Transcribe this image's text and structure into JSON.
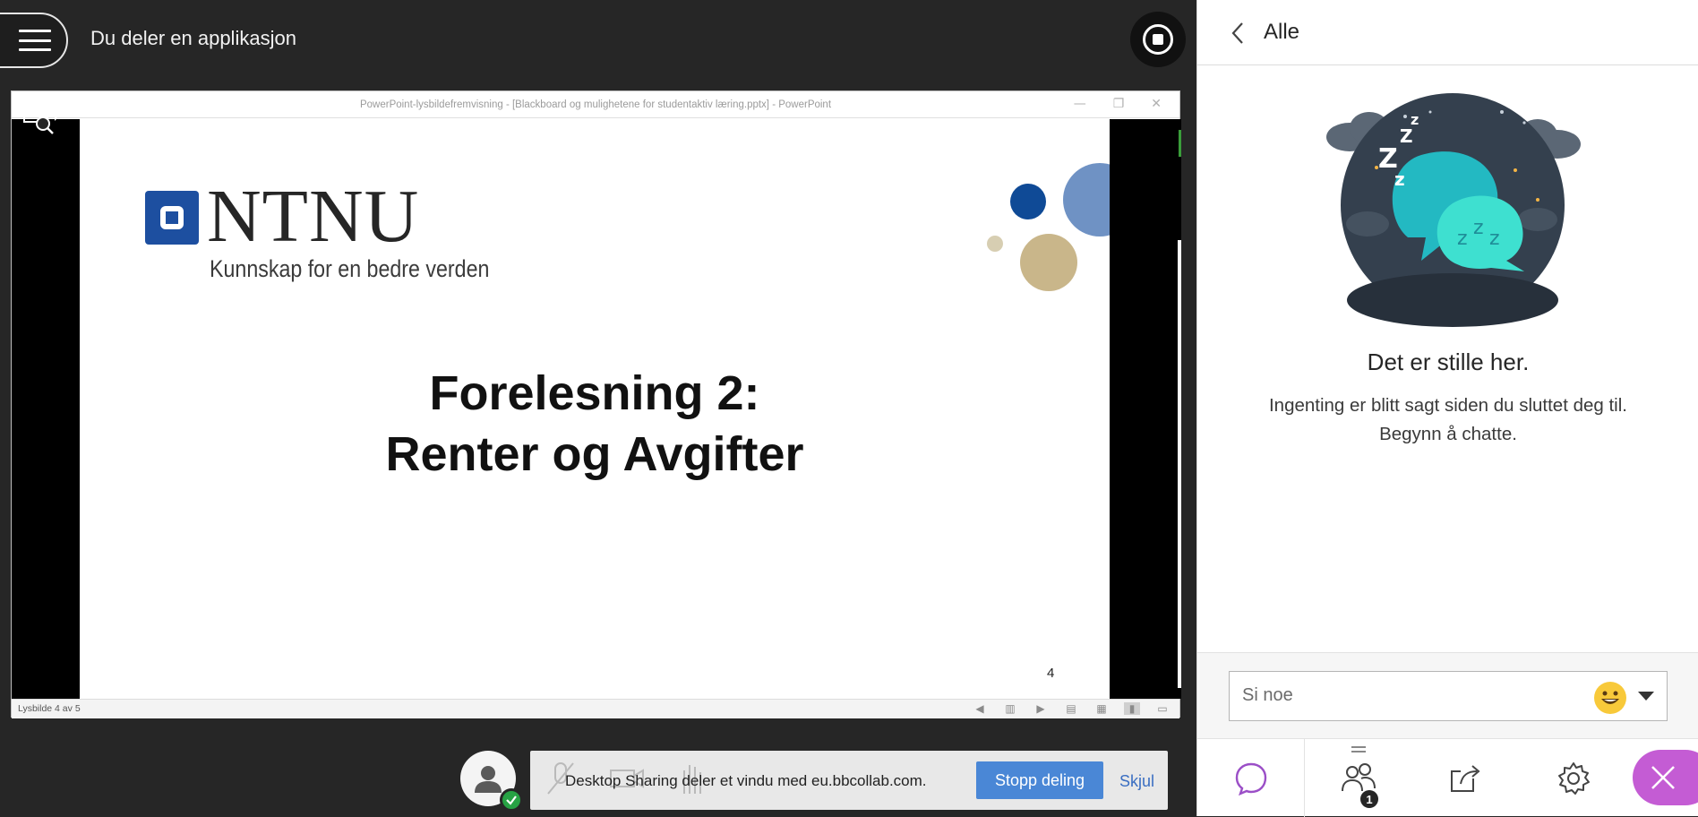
{
  "app": {
    "sharing_title": "Du deler en applikasjon"
  },
  "shared_window": {
    "titlebar": "PowerPoint-lysbildefremvisning - [Blackboard og mulighetene for studentaktiv læring.pptx] - PowerPoint",
    "slide": {
      "logo_word": "NTNU",
      "tagline": "Kunnskap for en bedre verden",
      "title_line1": "Forelesning 2:",
      "title_line2": "Renter og Avgifter",
      "number": "4"
    },
    "status": "Lysbilde 4 av 5"
  },
  "share_bar": {
    "message": "Desktop Sharing deler et vindu med eu.bbcollab.com.",
    "stop_label": "Stopp deling",
    "hide_label": "Skjul"
  },
  "panel": {
    "header_title": "Alle",
    "empty_heading": "Det er stille her.",
    "empty_line1": "Ingenting er blitt sagt siden du sluttet deg til.",
    "empty_line2": "Begynn å chatte.",
    "compose_placeholder": "Si noe",
    "participants_badge": "1"
  },
  "colors": {
    "accent_blue": "#4a87d6",
    "close_purple": "#c45cd4",
    "chat_active": "#9b4fc7",
    "ntnu_blue": "#1d4fa0"
  },
  "icons": [
    "menu-icon",
    "stop-share-icon",
    "magnifier-icon",
    "back-chevron-icon",
    "emoji-icon",
    "caret-down-icon",
    "chat-icon",
    "participants-icon",
    "share-content-icon",
    "settings-icon",
    "close-icon",
    "user-avatar-icon",
    "check-icon"
  ]
}
